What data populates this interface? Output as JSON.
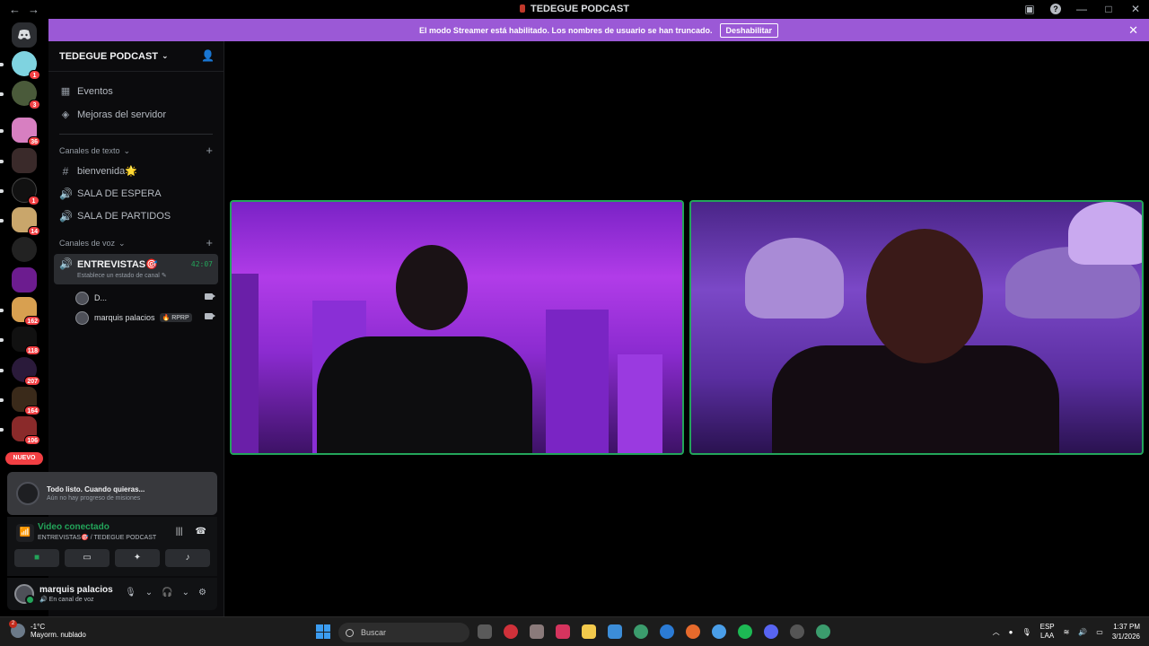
{
  "window": {
    "title": "TEDEGUE PODCAST"
  },
  "banner": {
    "message": "El modo Streamer está habilitado. Los nombres de usuario se han truncado.",
    "button": "Deshabilitar"
  },
  "server": {
    "name": "TEDEGUE PODCAST",
    "nav": [
      {
        "label": "Eventos",
        "icon": "calendar-icon"
      },
      {
        "label": "Mejoras del servidor",
        "icon": "boost-icon"
      }
    ],
    "text_category": "Canales de texto",
    "text_channels": [
      {
        "label": "bienvenida🌟",
        "icon": "hash-icon"
      },
      {
        "label": "SALA DE ESPERA",
        "icon": "speaker-icon"
      },
      {
        "label": "SALA DE PARTIDOS",
        "icon": "speaker-icon"
      }
    ],
    "voice_category": "Canales de voz",
    "active_voice": {
      "label": "ENTREVISTAS🎯",
      "timer": "42:07",
      "status": "Establece un estado de canal"
    },
    "voice_users": [
      {
        "name": "D...",
        "tag": ""
      },
      {
        "name": "marquis palacios",
        "tag": "RPRP"
      }
    ]
  },
  "rail": {
    "badges": [
      "1",
      "3",
      "36",
      "1",
      "14",
      "162",
      "118",
      "207",
      "164",
      "106"
    ],
    "nuevo": "NUEVO"
  },
  "quest": {
    "title": "Todo listo. Cuando quieras...",
    "subtitle": "Aún no hay progreso de misiones"
  },
  "rtc": {
    "status": "Video conectado",
    "location": "ENTREVISTAS🎯 / TEDEGUE PODCAST"
  },
  "user": {
    "name": "marquis palacios",
    "status": "En canal de voz"
  },
  "taskbar": {
    "temp": "-1°C",
    "weather": "Mayorm. nublado",
    "weather_badge": "2",
    "search_placeholder": "Buscar",
    "lang1": "ESP",
    "lang2": "LAA",
    "time": "1:37 PM",
    "date": "3/1/2026"
  },
  "colors": {
    "accent": "#9b59d6",
    "voice_green": "#23a55a",
    "badge_red": "#f23f43"
  }
}
